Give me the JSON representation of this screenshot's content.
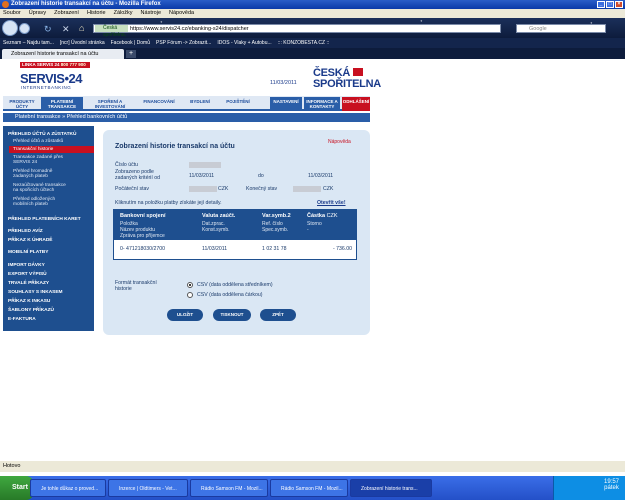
{
  "window": {
    "title": "Zobrazení historie transakcí na účtu - Mozilla Firefox"
  },
  "menu": [
    "Soubor",
    "Úpravy",
    "Zobrazení",
    "Historie",
    "Záložky",
    "Nástroje",
    "Nápověda"
  ],
  "urlbar": {
    "site": "Česká spořitelna, a.s. [CZ]",
    "url": "https://www.servis24.cz/ebanking-s24/dispatcher"
  },
  "search": {
    "placeholder": "Google"
  },
  "bookmarks": [
    "Seznam – Najdu tam...",
    "[ncr] Úvodní stránka",
    "Facebook | Domů",
    "PSP Fórum -> Zobrazit...",
    "IDOS - Vlaky + Autobu...",
    "::: KONZOBESTA.CZ ::"
  ],
  "tab": {
    "label": "Zobrazení historie transakcí na účtu"
  },
  "banner": {
    "linka": "LINKA SERVIS 24",
    "phone": "800 777 900",
    "brand": "SERVIS•24",
    "brand_sub": "INTERNETBANKING",
    "date": "11/03/2011",
    "bank1": "ČESKÁ",
    "bank2": "SPOŘITELNA"
  },
  "nav": {
    "produkty": "PRODUKTY ÚČTY",
    "platebni": "PLATEBNÍ TRANSAKCE",
    "sporeni": "SPOŘENÍ A INVESTOVÁNÍ",
    "financovani": "FINANCOVÁNÍ",
    "bydleni": "BYDLENÍ",
    "pojisteni": "POJIŠTĚNÍ",
    "nastaveni": "NASTAVENÍ",
    "informace": "INFORMACE A KONTAKTY",
    "odhlaseni": "ODHLÁŠENÍ"
  },
  "subnav": "Platební transakce » Přehled bankovních účtů",
  "sidebar": {
    "prehled": "PŘEHLED ÚČTŮ A ZŮSTATKŮ",
    "s1": "Přehled účtů a zůstatků",
    "s2": "Transakční historie",
    "s3a": "Transakce zadané přes",
    "s3b": "SERVIS 24",
    "s4a": "Přehled hromadně",
    "s4b": "zadaných plateb",
    "s5a": "Nezaúčtované transakce",
    "s5b": "na spořicích účtech",
    "s6a": "Přehled odložených",
    "s6b": "mobilních plateb",
    "platkaret": "PŘEHLED PLATEBNÍCH KARET",
    "avizo": "PŘEHLED AVÍZ",
    "prikaz": "PŘÍKAZ K ÚHRADĚ",
    "mobilni": "MOBILNÍ PLATBY",
    "import": "IMPORT DÁVKY",
    "export": "EXPORT VÝPISŮ",
    "trvale": "TRVALÉ PŘÍKAZY",
    "souhlasy": "SOUHLASY S INKASEM",
    "inkaso": "PŘÍKAZ K INKASU",
    "sablony": "ŠABLONY PŘÍKAZŮ",
    "efaktura": "E-FAKTURA"
  },
  "panel": {
    "title": "Zobrazení historie transakcí na účtu",
    "help": "Nápověda",
    "cislo_label": "Číslo účtu",
    "zobrazeno_label1": "Zobrazeno podle",
    "zobrazeno_label2": "zadaných kritérií od",
    "date_from": "11/03/2011",
    "do_label": "do",
    "date_to": "11/03/2011",
    "pocatecni_label": "Počáteční stav",
    "pocatecni_cur": "CZK",
    "konecny_label": "Konečný stav",
    "konecny_cur": "CZK",
    "hint": "Kliknutím na položku platby získáte její detaily.",
    "otevrit": "Otevřít vše!",
    "format_label1": "Formát transakční",
    "format_label2": "historie",
    "csv1": "CSV (data oddělena středníkem)",
    "csv2": "CSV (data oddělena čárkou)",
    "ulozit": "ULOŽIT",
    "tisknout": "TISKNOUT",
    "zpet": "ZPĚT"
  },
  "table": {
    "h1": "Bankovní spojení",
    "h1a": "Položka",
    "h1b": "Název produktu",
    "h1c": "Zpráva pro příjemce",
    "h2": "Valuta zaúčt.",
    "h2a": "Dat.zprac.",
    "h2b": "Konst.symb.",
    "h3": "Var.symb.2",
    "h3a": "Ref. číslo",
    "h3b": "Spec.symb.",
    "h4": "Částka",
    "h4cur": "CZK",
    "h4a": "Storno",
    "h4b": "-",
    "rows": [
      {
        "account": "0- 471218030/2700",
        "date": "11/03/2011",
        "vs": "1 02 31 78",
        "amount": "- 736.00"
      }
    ]
  },
  "status": "Hotovo",
  "taskbar": {
    "start": "Start",
    "items": [
      "Je tohle důkaz o proved...",
      "Inzerce | Oldtimers - Vet...",
      "Rádio Samson FM - Mozil...",
      "Rádio Samson FM - Mozil...",
      "Zobrazení historie trans..."
    ],
    "time": "19:57",
    "day": "pátek"
  }
}
